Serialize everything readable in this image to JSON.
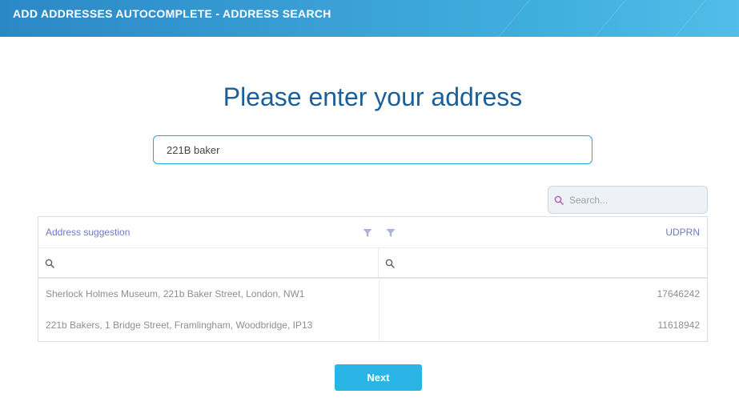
{
  "header": {
    "title": "ADD ADDRESSES AUTOCOMPLETE - ADDRESS SEARCH"
  },
  "main": {
    "heading": "Please enter your address",
    "address_input": {
      "value": "221B baker",
      "placeholder": ""
    }
  },
  "grid": {
    "search": {
      "placeholder": "Search...",
      "icon": "search-icon"
    },
    "columns": [
      {
        "label": "Address suggestion",
        "filter_icon": "funnel-icon"
      },
      {
        "label": "UDPRN",
        "filter_icon": "funnel-icon"
      }
    ],
    "rows": [
      {
        "address": "Sherlock Holmes Museum, 221b Baker Street, London, NW1",
        "udprn": "17646242"
      },
      {
        "address": "221b Bakers, 1 Bridge Street, Framlingham, Woodbridge, IP13",
        "udprn": "11618942"
      }
    ]
  },
  "footer": {
    "next_label": "Next"
  },
  "colors": {
    "header_gradient_start": "#2a88c6",
    "header_gradient_end": "#52bde8",
    "heading": "#1a5f9a",
    "input_border": "#1eaad8",
    "column_header_text": "#6c7bc4",
    "button": "#2ab5e6"
  }
}
